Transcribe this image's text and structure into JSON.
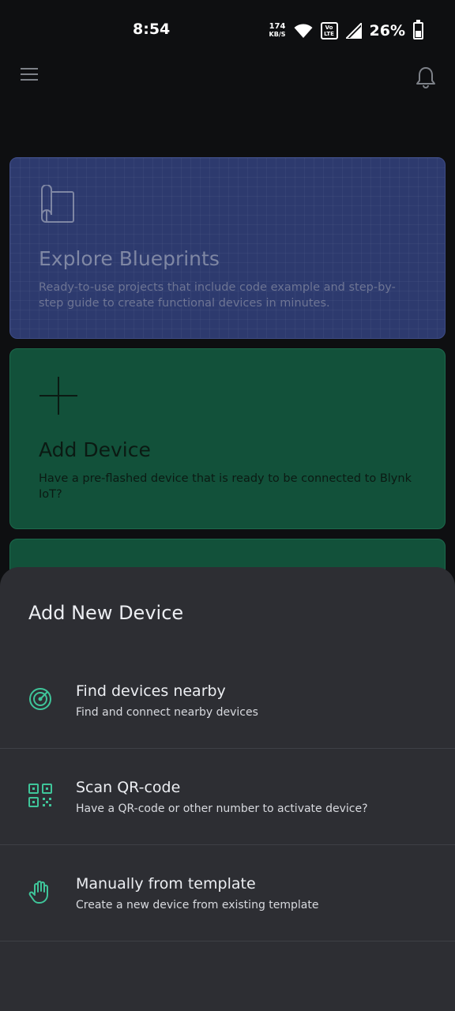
{
  "status_bar": {
    "time": "8:54",
    "net_speed_value": "174",
    "net_speed_unit": "KB/S",
    "volte_top": "Vo",
    "volte_bottom": "LTE",
    "battery_percent": "26%",
    "icons": [
      "wifi-icon",
      "volte-icon",
      "signal-icon",
      "battery-icon"
    ]
  },
  "app_bar": {
    "icons": [
      "menu-icon",
      "bell-icon"
    ]
  },
  "cards": [
    {
      "title": "Explore Blueprints",
      "description": "Ready-to-use projects that include code example and step-by-step guide to create functional devices in minutes.",
      "icon": "blueprint-icon",
      "color": "#2d3a6e"
    },
    {
      "title": "Add Device",
      "description": "Have a pre-flashed device that is ready to be connected to Blynk IoT?",
      "icon": "plus-icon",
      "color": "#12513a"
    }
  ],
  "sheet": {
    "title": "Add New Device",
    "options": [
      {
        "title": "Find devices nearby",
        "description": "Find and connect nearby devices",
        "icon": "radar-icon"
      },
      {
        "title": "Scan QR-code",
        "description": "Have a QR-code or other number to activate device?",
        "icon": "qr-code-icon"
      },
      {
        "title": "Manually from template",
        "description": "Create a new device from existing template",
        "icon": "hand-icon"
      }
    ],
    "accent_color": "#3fc59a"
  }
}
